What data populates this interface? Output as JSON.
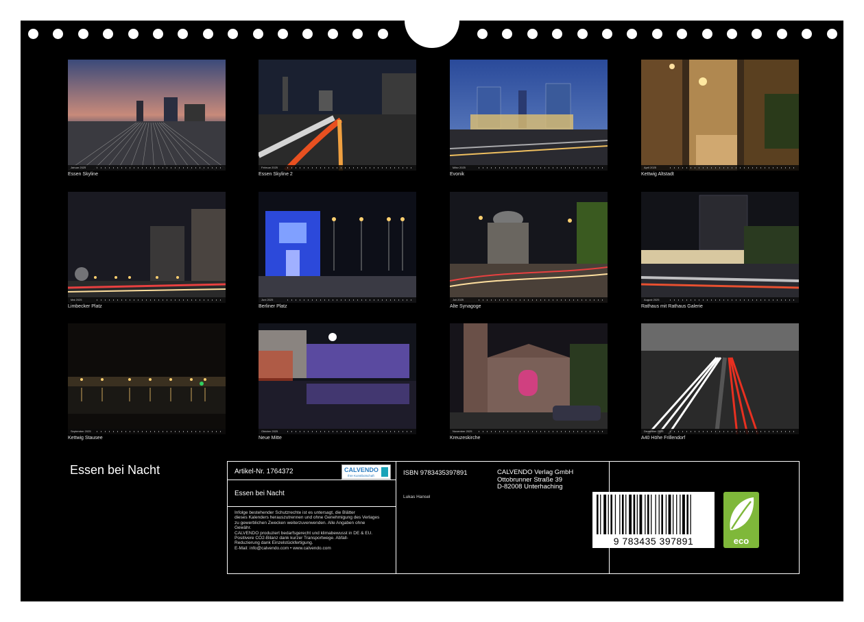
{
  "title": "Essen bei Nacht",
  "photos": [
    {
      "caption": "Essen Skyline",
      "month": "Januar 2025"
    },
    {
      "caption": "Essen Skyline 2",
      "month": "Februar 2025"
    },
    {
      "caption": "Evonik",
      "month": "März 2025"
    },
    {
      "caption": "Kettwig Altstadt",
      "month": "April 2025"
    },
    {
      "caption": "Limbecker Platz",
      "month": "Mai 2025"
    },
    {
      "caption": "Berliner Platz",
      "month": "Juni 2025"
    },
    {
      "caption": "Alte Synagoge",
      "month": "Juli 2025"
    },
    {
      "caption": "Rathaus mit Rathaus Galerie",
      "month": "August 2025"
    },
    {
      "caption": "Kettwig Stausee",
      "month": "September 2025"
    },
    {
      "caption": "Neue Mitte",
      "month": "Oktober 2025"
    },
    {
      "caption": "Kreuzeskirche",
      "month": "November 2025"
    },
    {
      "caption": "A40 Höhe Frillendorf",
      "month": "Dezember 2025"
    }
  ],
  "info": {
    "article": "Artikel-Nr. 1764372",
    "calendar_title": "Essen bei Nacht",
    "legal": [
      "Infolge bestehender Schutzrechte ist es untersagt, die Blätter",
      "dieses Kalenders herauszutrennen und ohne Genehmigung des Verlages",
      "zu gewerblichen Zwecken weiterzuverwenden. Alle Angaben ohne",
      "Gewähr.",
      "CALVENDO produziert bedarfsgerecht und klimabewusst in DE & EU.",
      "Positivere CO2-Bilanz dank kurzer Transportwege. Abfall-",
      "Reduzierung dank Einzelstückfertigung.",
      "E-Mail: info@calvendo.com • www.calvendo.com"
    ],
    "isbn": "ISBN 9783435397891",
    "publisher": [
      "CALVENDO Verlag GmbH",
      "Ottobrunner Straße 39",
      "D-82008 Unterhaching"
    ],
    "author": "Lukas Hansel",
    "logo_word": "CALVENDO",
    "logo_sub": "Ihre Kunstbotschaft",
    "barcode_number": "9 783435 397891",
    "eco_label": "eco"
  }
}
